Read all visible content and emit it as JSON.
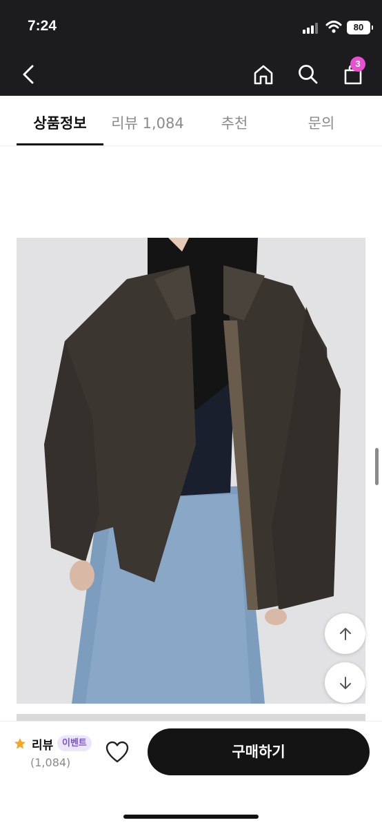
{
  "status_bar": {
    "time": "7:24",
    "battery": "80"
  },
  "nav": {
    "cart_count": "3"
  },
  "tabs": [
    {
      "label": "상품정보",
      "active": true
    },
    {
      "label": "리뷰 1,084",
      "active": false
    },
    {
      "label": "추천",
      "active": false
    },
    {
      "label": "문의",
      "active": false
    }
  ],
  "bottom_bar": {
    "review_label": "리뷰",
    "event_badge": "이벤트",
    "review_count": "(1,084)",
    "buy_label": "구매하기"
  },
  "colors": {
    "header_bg": "#1c1c1e",
    "badge_pink": "#e94fd1",
    "event_purple": "#7b4fe0",
    "star_orange": "#f5a623",
    "buy_button": "#141414"
  },
  "icons": [
    "back-arrow-icon",
    "home-icon",
    "search-icon",
    "shopping-bag-icon",
    "star-icon",
    "heart-icon",
    "arrow-up-icon",
    "arrow-down-icon"
  ]
}
